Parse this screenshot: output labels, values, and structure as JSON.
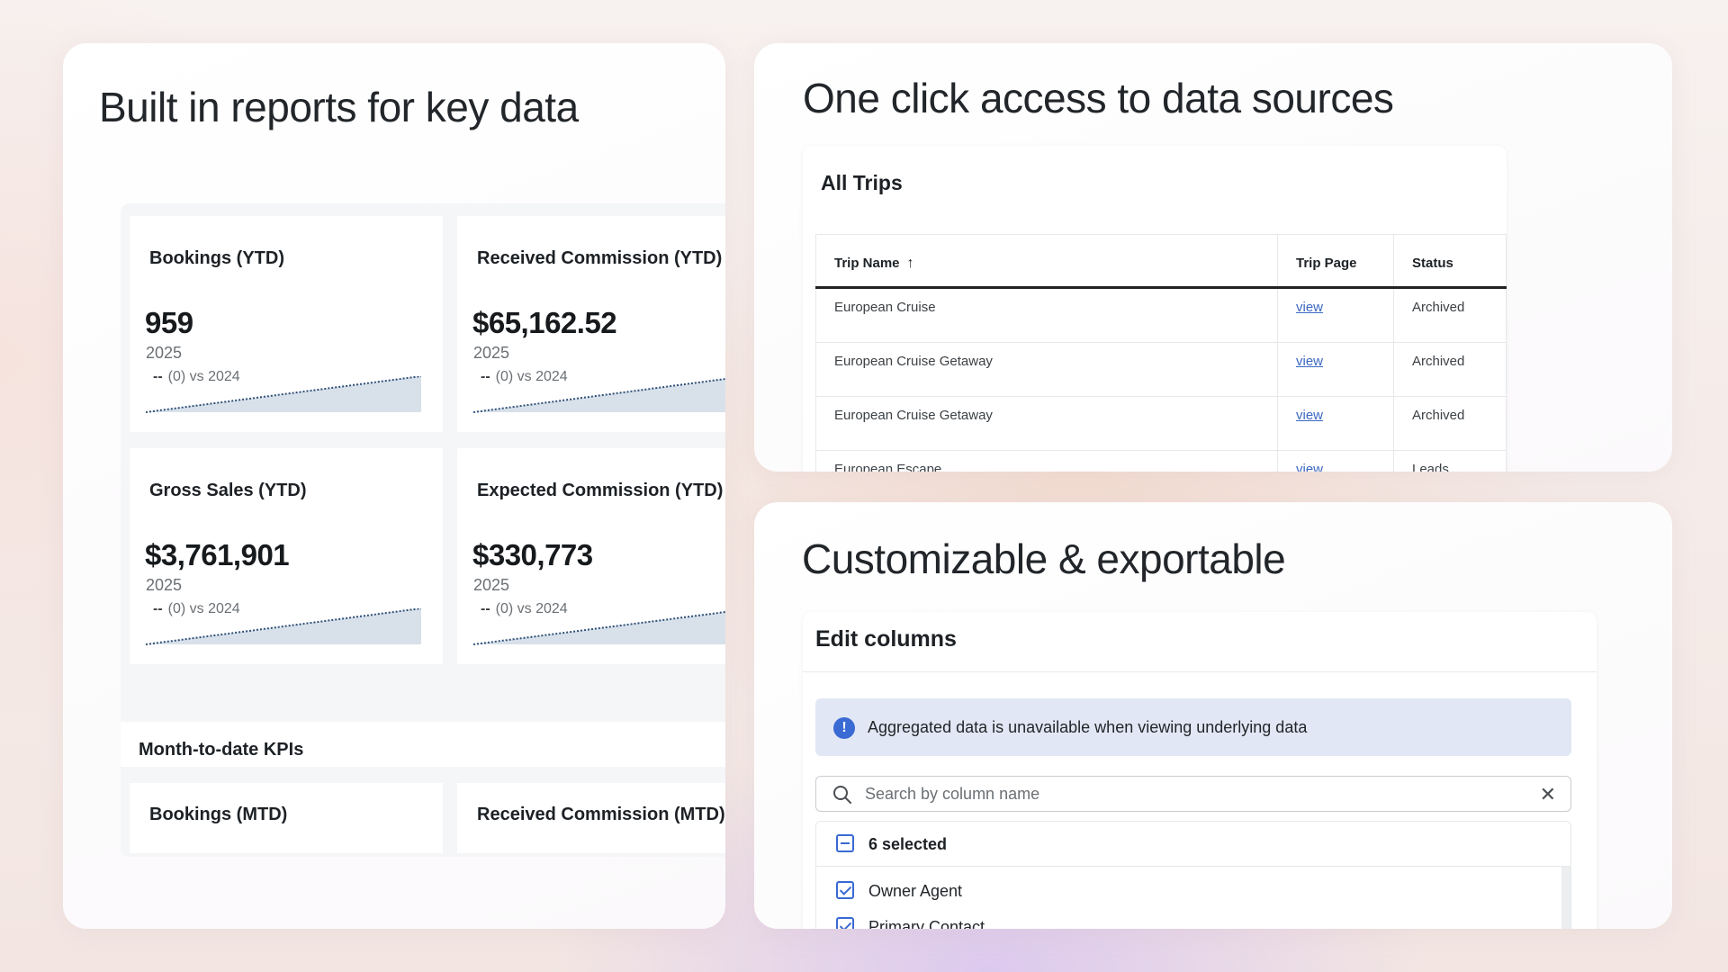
{
  "left_panel": {
    "title": "Built in reports for key data",
    "ytd_cards": [
      {
        "title": "Bookings (YTD)",
        "value": "959",
        "year": "2025",
        "cmp_dash": "--",
        "comparison": "(0) vs 2024"
      },
      {
        "title": "Received Commission (YTD)",
        "value": "$65,162.52",
        "year": "2025",
        "cmp_dash": "--",
        "comparison": "(0) vs 2024"
      },
      {
        "title": "Gross Sales (YTD)",
        "value": "$3,761,901",
        "year": "2025",
        "cmp_dash": "--",
        "comparison": "(0) vs 2024"
      },
      {
        "title": "Expected Commission (YTD)",
        "value": "$330,773",
        "year": "2025",
        "cmp_dash": "--",
        "comparison": "(0) vs 2024"
      }
    ],
    "section_label": "Month-to-date KPIs",
    "mtd_cards": [
      {
        "title": "Bookings (MTD)"
      },
      {
        "title": "Received Commission (MTD)"
      }
    ]
  },
  "top_right_panel": {
    "title": "One click access to data sources",
    "table_title": "All Trips",
    "columns": [
      "Trip Name",
      "Trip Page",
      "Status"
    ],
    "rows": [
      {
        "name": "European Cruise",
        "page": "view",
        "status": "Archived"
      },
      {
        "name": "European Cruise Getaway",
        "page": "view",
        "status": "Archived"
      },
      {
        "name": "European Cruise Getaway",
        "page": "view",
        "status": "Archived"
      },
      {
        "name": "European Escape",
        "page": "view",
        "status": "Leads"
      }
    ]
  },
  "bottom_right_panel": {
    "title": "Customizable & exportable",
    "dialog_title": "Edit columns",
    "banner_text": "Aggregated data is unavailable when viewing underlying data",
    "search_placeholder": "Search by column name",
    "selected_label": "6 selected",
    "column_items": [
      "Owner Agent",
      "Primary Contact"
    ]
  },
  "colors": {
    "accent": "#3a6ad3",
    "link": "#3b68c2",
    "banner_bg": "#e1e7f4",
    "sparkline_fill": "#d8e1ea",
    "sparkline_line": "#2f4f78"
  },
  "icons": [
    "sort-ascending-icon",
    "info-icon",
    "search-icon",
    "close-icon",
    "checkbox-indeterminate-icon",
    "checkbox-checked-icon",
    "sparkline-icon"
  ]
}
